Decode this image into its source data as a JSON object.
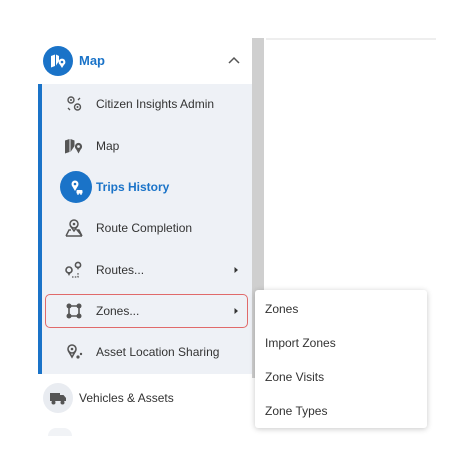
{
  "sidebar": {
    "header": {
      "label": "Map",
      "icon": "map-pin-icon",
      "expanded": true
    },
    "items": [
      {
        "label": "Citizen Insights Admin",
        "icon": "insights-icon"
      },
      {
        "label": "Map",
        "icon": "map-icon"
      },
      {
        "label": "Trips History",
        "icon": "trips-history-icon",
        "selected": true
      },
      {
        "label": "Route Completion",
        "icon": "route-completion-icon"
      },
      {
        "label": "Routes...",
        "icon": "routes-icon",
        "has_submenu": true
      },
      {
        "label": "Zones...",
        "icon": "zones-icon",
        "has_submenu": true,
        "focused": true
      },
      {
        "label": "Asset Location Sharing",
        "icon": "asset-location-icon"
      }
    ],
    "vehicles": {
      "label": "Vehicles & Assets",
      "icon": "truck-icon"
    }
  },
  "zones_menu": {
    "items": [
      {
        "label": "Zones"
      },
      {
        "label": "Import Zones"
      },
      {
        "label": "Zone Visits"
      },
      {
        "label": "Zone Types"
      }
    ]
  },
  "colors": {
    "accent": "#1a73c8",
    "focus_outline": "#e06a6a",
    "submenu_bg": "#eef1f6",
    "text": "#333333"
  }
}
